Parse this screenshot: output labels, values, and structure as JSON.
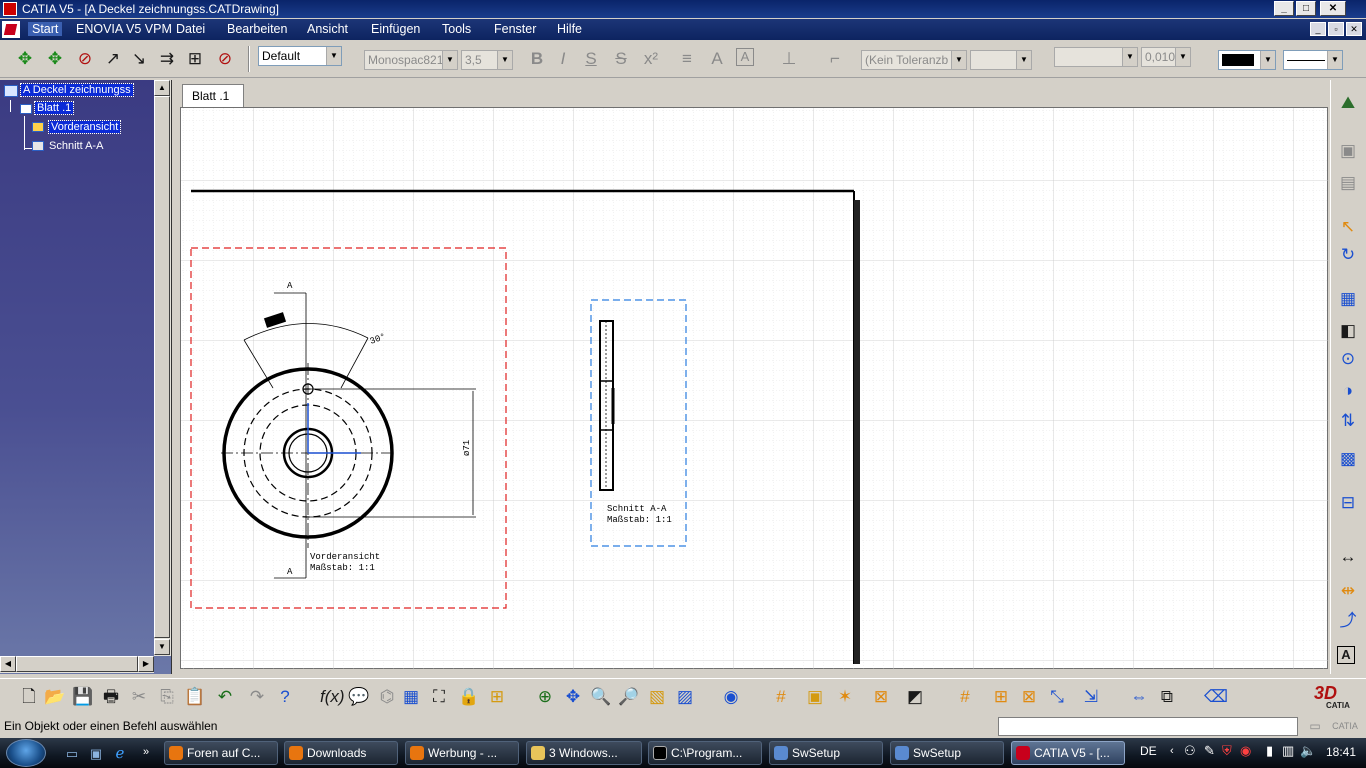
{
  "window": {
    "title": "CATIA V5 - [A Deckel zeichnungss.CATDrawing]"
  },
  "menu": [
    "Start",
    "ENOVIA V5 VPM",
    "Datei",
    "Bearbeiten",
    "Ansicht",
    "Einfügen",
    "Tools",
    "Fenster",
    "Hilfe"
  ],
  "format_toolbar": {
    "style": "Default",
    "font": "Monospac821",
    "font_size": "3,5",
    "tolerance": "(Kein Toleranzb",
    "precision": "0,0100"
  },
  "tree": {
    "root": "A Deckel zeichnungss",
    "sheet": "Blatt .1",
    "views": [
      "Vorderansicht",
      "Schnitt A-A"
    ]
  },
  "tab_label": "Blatt .1",
  "drawing": {
    "section_marker": "A",
    "angle_label": "30°",
    "diameter_label": "ø71",
    "front_view_caption": "Vorderansicht",
    "front_view_scale": "Maßstab:  1:1",
    "section_caption": "Schnitt A-A",
    "section_scale": "Maßstab:  1:1"
  },
  "status": {
    "message": "Ein Objekt oder einen Befehl auswählen"
  },
  "taskbar": {
    "tasks": [
      "Foren auf C...",
      "Downloads",
      "Werbung - ...",
      "3 Windows...",
      "C:\\Program...",
      "SwSetup",
      "SwSetup",
      "CATIA V5 - [..."
    ],
    "language": "DE",
    "clock": "18:41"
  }
}
